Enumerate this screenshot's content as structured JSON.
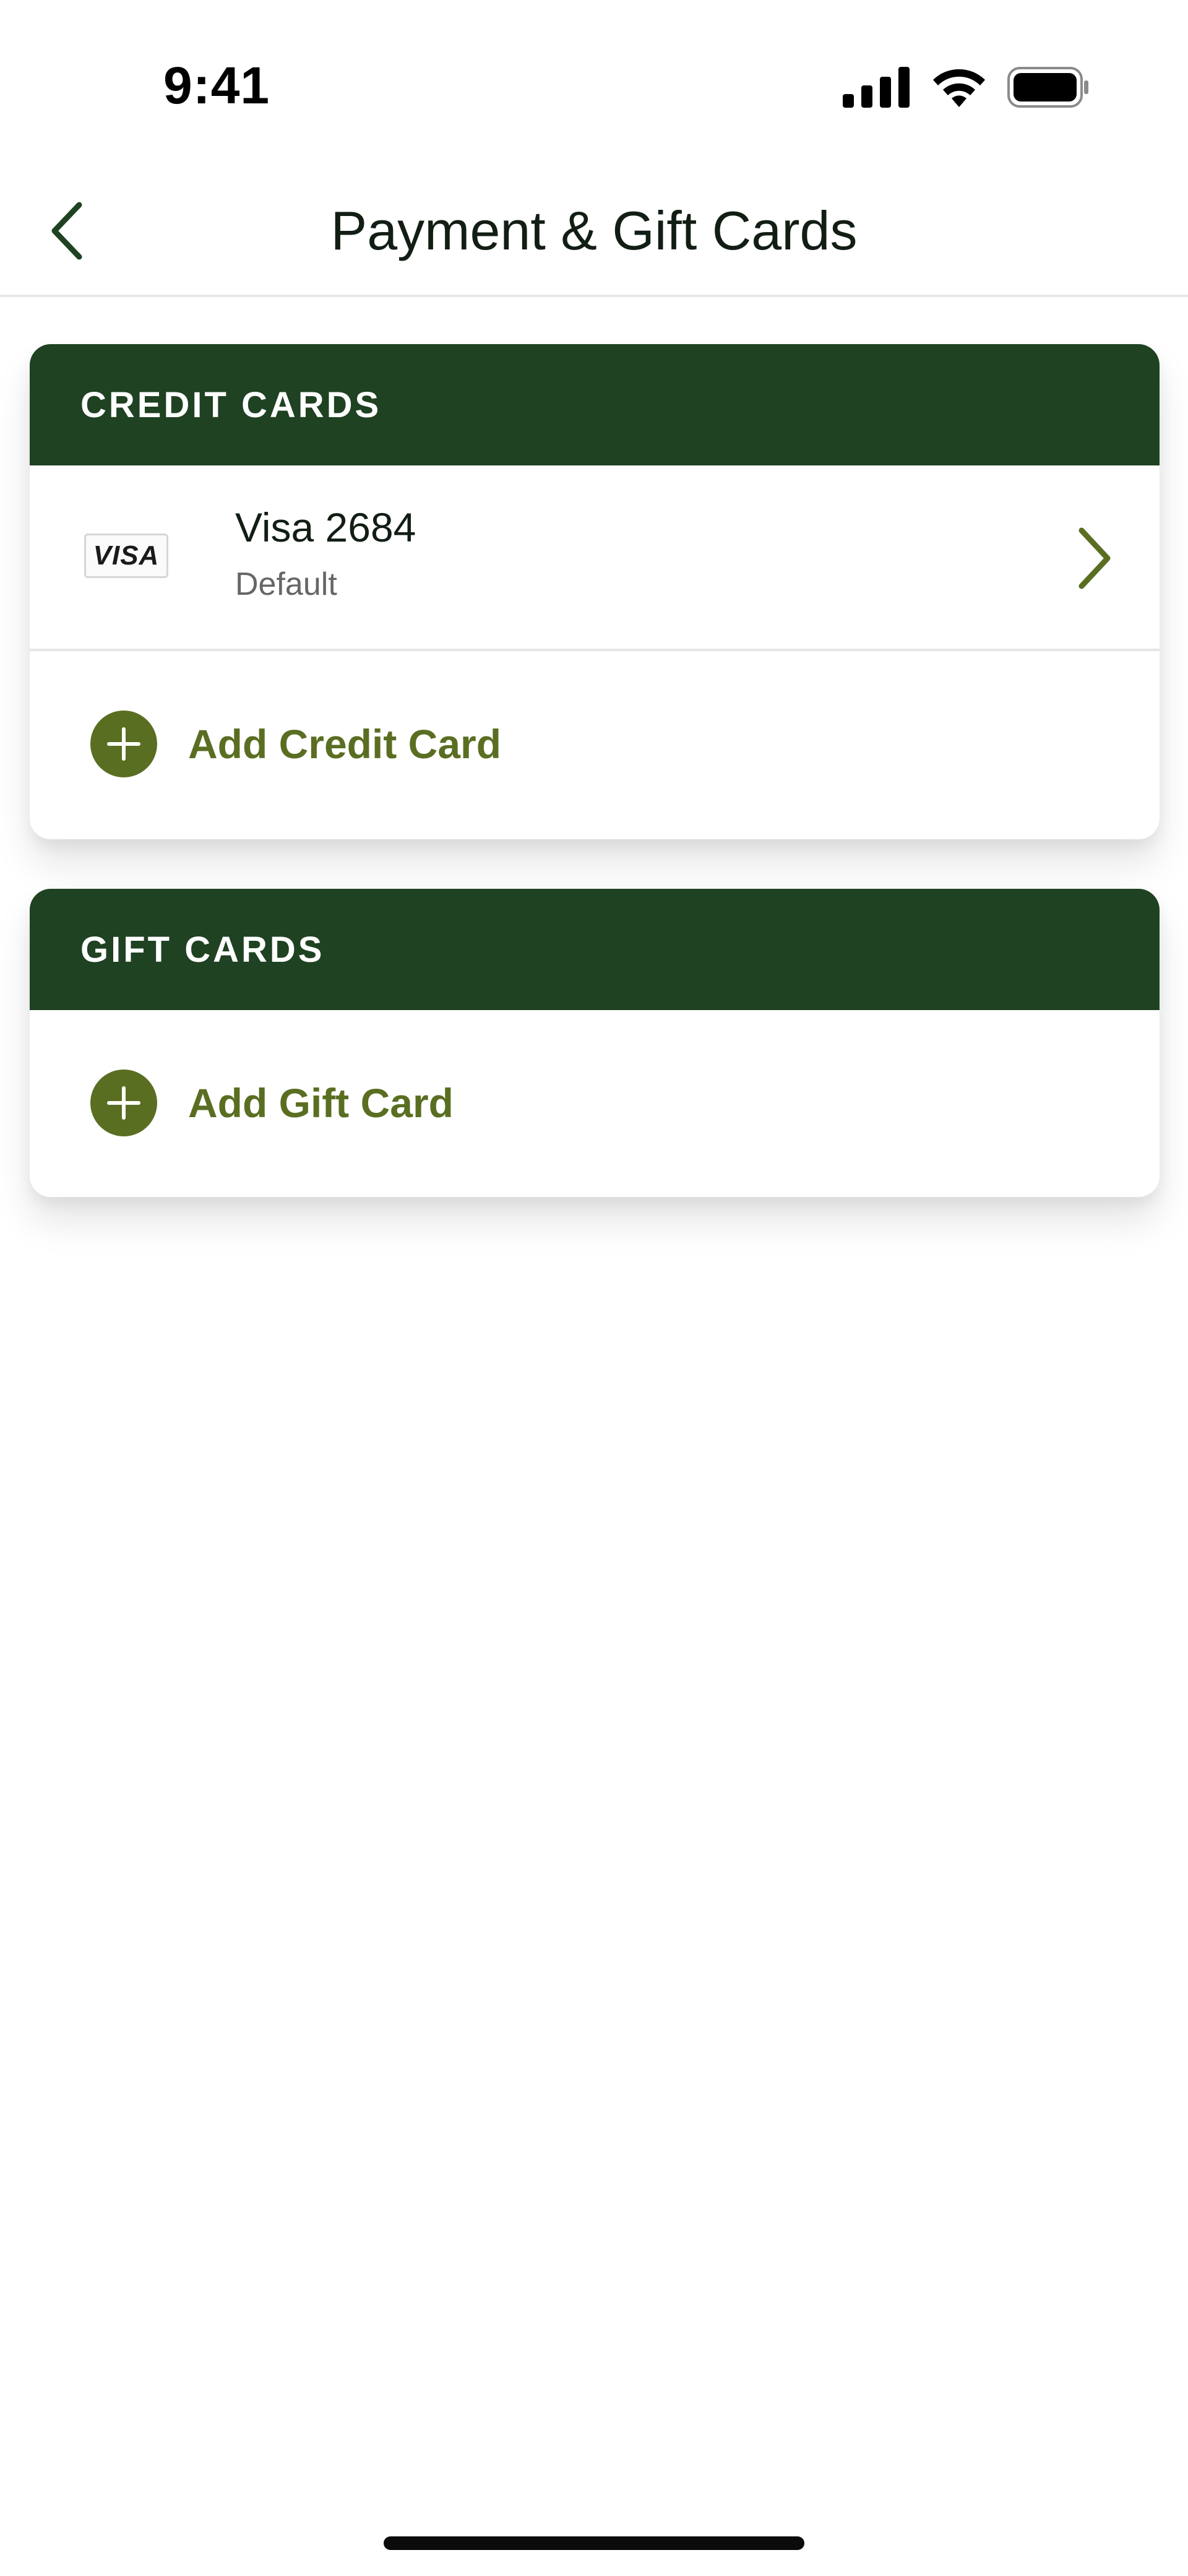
{
  "status_bar": {
    "time": "9:41",
    "icons": [
      "signal-icon",
      "wifi-icon",
      "battery-icon"
    ]
  },
  "header": {
    "back_icon": "chevron-left-icon",
    "title": "Payment & Gift Cards"
  },
  "credit_cards": {
    "section_label": "CREDIT CARDS",
    "items": [
      {
        "brand_logo": "VISA",
        "name": "Visa 2684",
        "subtitle": "Default",
        "icon": "chevron-right-icon"
      }
    ],
    "add_label": "Add Credit Card",
    "add_icon": "plus-circle-icon"
  },
  "gift_cards": {
    "section_label": "GIFT CARDS",
    "add_label": "Add Gift Card",
    "add_icon": "plus-circle-icon"
  },
  "colors": {
    "header_green": "#1f4222",
    "accent_olive": "#5a6e22",
    "title_text": "#121e14",
    "subtitle_text": "#666666"
  }
}
